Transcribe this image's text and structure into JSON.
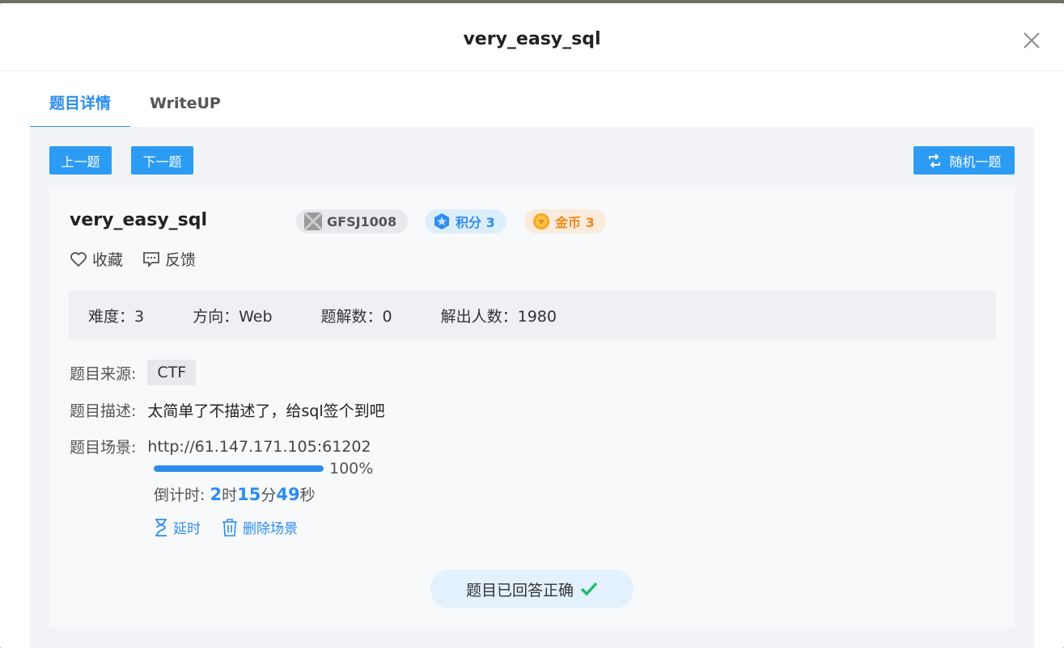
{
  "dialog": {
    "title": "very_easy_sql"
  },
  "tabs": [
    {
      "label": "题目详情",
      "active": true
    },
    {
      "label": "WriteUP",
      "active": false
    }
  ],
  "nav": {
    "prev_label": "上一题",
    "next_label": "下一题",
    "random_label": "随机一题"
  },
  "problem": {
    "title": "very_easy_sql",
    "id": "GFSJ1008",
    "score_label": "积分 3",
    "coin_label": "金币 3",
    "favorite_label": "收藏",
    "feedback_label": "反馈"
  },
  "stats": {
    "difficulty": "难度：3",
    "direction": "方向：Web",
    "solutions": "题解数：0",
    "solvers": "解出人数：1980"
  },
  "details": {
    "source_label": "题目来源:",
    "source_value": "CTF",
    "desc_label": "题目描述:",
    "desc_value": "太简单了不描述了，给sql签个到吧",
    "scene_label": "题目场景:",
    "scene_url": "http://61.147.171.105:61202",
    "progress": 100,
    "progress_text": "100%",
    "countdown_label": "倒计时: ",
    "hours": "2",
    "hours_unit": "时",
    "minutes": "15",
    "minutes_unit": "分",
    "seconds": "49",
    "seconds_unit": "秒",
    "extend_label": "延时",
    "delete_label": "删除场景"
  },
  "status": {
    "answered_label": "题目已回答正确"
  },
  "colors": {
    "accent": "#2d8cf0",
    "button": "#2b9bf4",
    "success": "#19be6b",
    "coin": "#f08a1a"
  }
}
